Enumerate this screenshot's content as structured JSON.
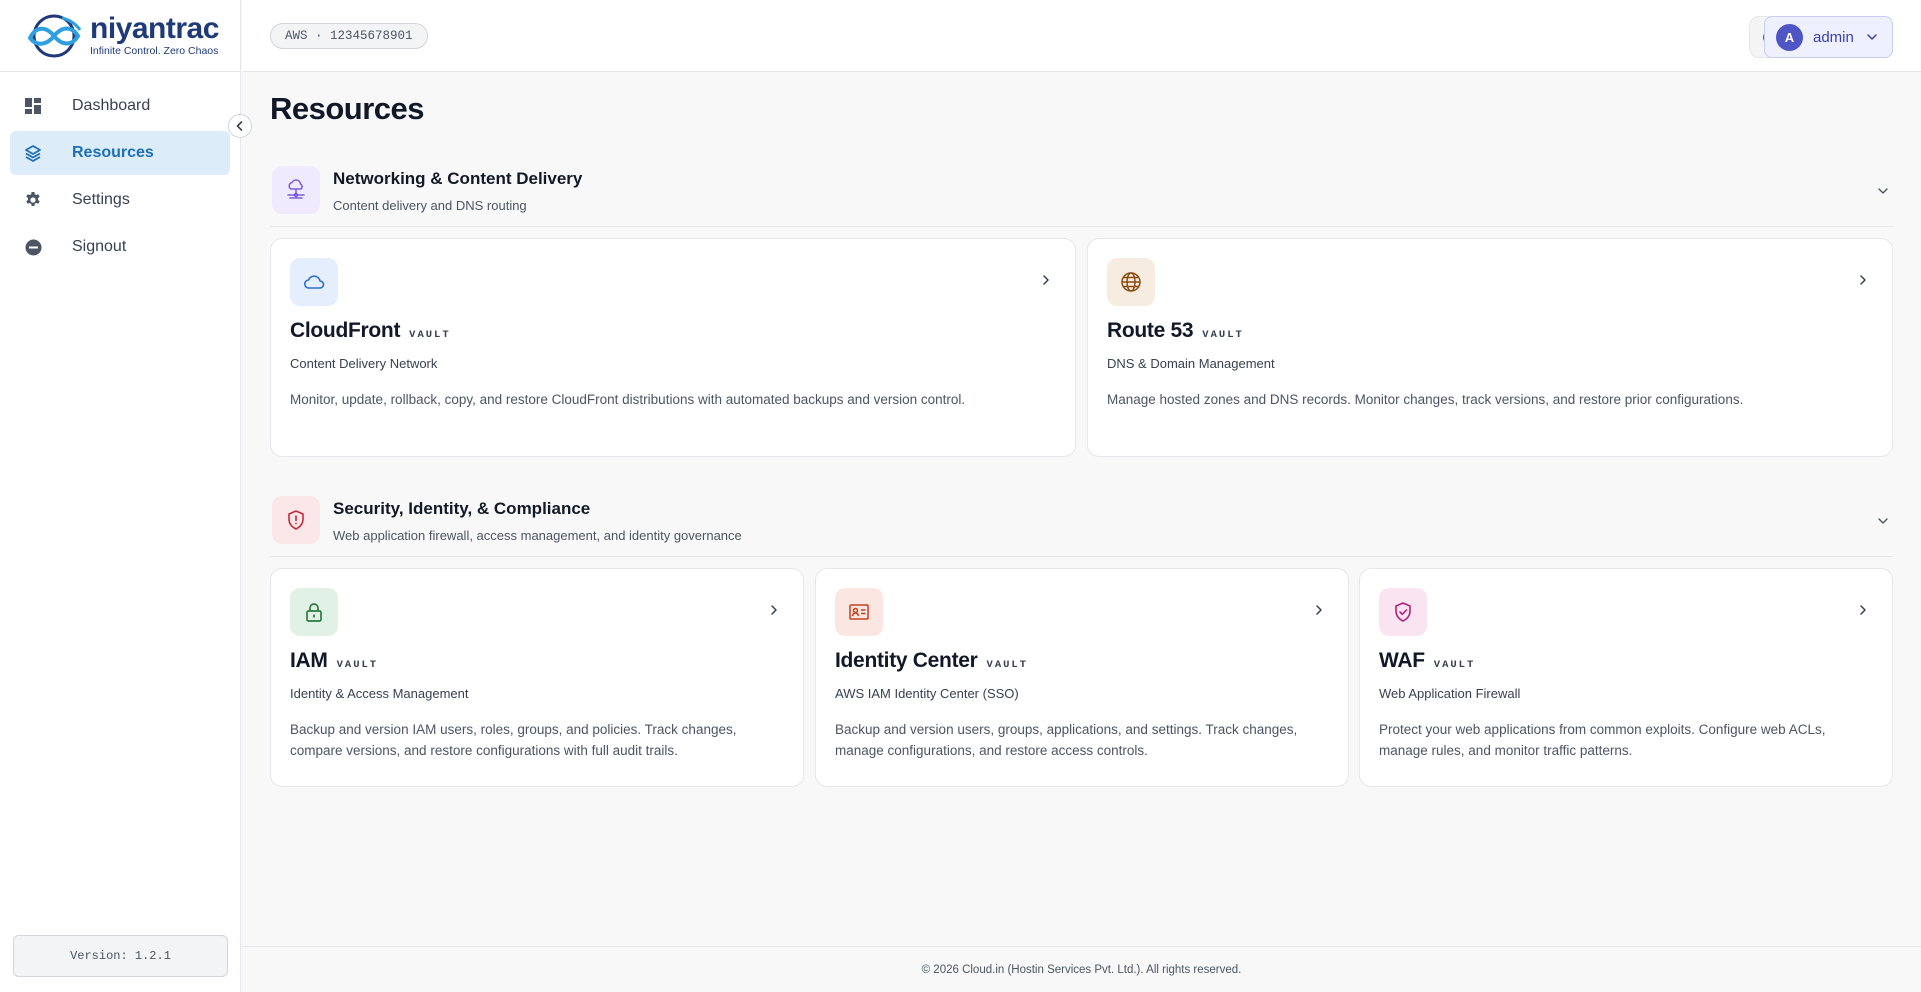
{
  "brand": {
    "name": "niyantrac",
    "tagline": "Infinite Control. Zero Chaos"
  },
  "sidebar": {
    "items": [
      {
        "label": "Dashboard",
        "icon": "dashboard-grid-icon",
        "active": false
      },
      {
        "label": "Resources",
        "icon": "layers-icon",
        "active": true
      },
      {
        "label": "Settings",
        "icon": "gear-icon",
        "active": false
      },
      {
        "label": "Signout",
        "icon": "signout-icon",
        "active": false
      }
    ],
    "version_label": "Version: 1.2.1"
  },
  "header": {
    "account": "AWS · 12345678901",
    "user_initial": "A",
    "user_name": "admin"
  },
  "main": {
    "title": "Resources",
    "sections": [
      {
        "title": "Networking & Content Delivery",
        "subtitle": "Content delivery and DNS routing",
        "cards": [
          {
            "name": "CloudFront",
            "badge": "VAULT",
            "subtitle": "Content Delivery Network",
            "description": "Monitor, update, rollback, copy, and restore CloudFront distributions with automated backups and version control."
          },
          {
            "name": "Route 53",
            "badge": "VAULT",
            "subtitle": "DNS & Domain Management",
            "description": "Manage hosted zones and DNS records. Monitor changes, track versions, and restore prior configurations."
          }
        ]
      },
      {
        "title": "Security, Identity, & Compliance",
        "subtitle": "Web application firewall, access management, and identity governance",
        "cards": [
          {
            "name": "IAM",
            "badge": "VAULT",
            "subtitle": "Identity & Access Management",
            "description": "Backup and version IAM users, roles, groups, and policies. Track changes, compare versions, and restore configurations with full audit trails."
          },
          {
            "name": "Identity Center",
            "badge": "VAULT",
            "subtitle": "AWS IAM Identity Center (SSO)",
            "description": "Backup and version users, groups, applications, and settings. Track changes, manage configurations, and restore access controls."
          },
          {
            "name": "WAF",
            "badge": "VAULT",
            "subtitle": "Web Application Firewall",
            "description": "Protect your web applications from common exploits. Configure web ACLs, manage rules, and monitor traffic patterns."
          }
        ]
      }
    ]
  },
  "footer": {
    "text": "© 2026 Cloud.in (Hostin Services Pvt. Ltd.). All rights reserved."
  },
  "colors": {
    "accent": "#1d6fb8",
    "active_nav_bg": "#dcecf8",
    "avatar": "#4f55c4",
    "brand": "#1e3a7a"
  }
}
